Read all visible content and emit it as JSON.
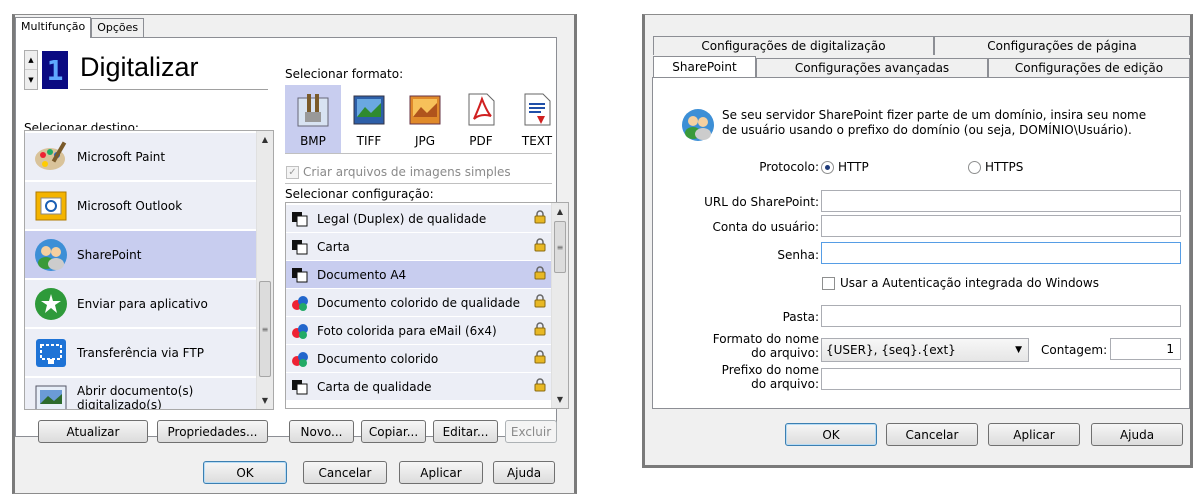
{
  "left_window": {
    "tabs": [
      {
        "label": "Multifunção"
      },
      {
        "label": "Opções"
      }
    ],
    "lcd_digit": "1",
    "title": "Digitalizar",
    "destination_label": "Selecionar destino:",
    "destinations": [
      {
        "label": "Microsoft Paint",
        "icon": "paint-palette-icon"
      },
      {
        "label": "Microsoft Outlook",
        "icon": "outlook-icon"
      },
      {
        "label": "SharePoint",
        "icon": "sharepoint-users-icon"
      },
      {
        "label": "Enviar para aplicativo",
        "icon": "send-app-icon"
      },
      {
        "label": "Transferência via FTP",
        "icon": "ftp-icon"
      },
      {
        "label": "Abrir documento(s) digitalizado(s)",
        "icon": "open-document-icon"
      }
    ],
    "format_label": "Selecionar formato:",
    "formats": [
      {
        "label": "BMP",
        "icon": "bmp-icon"
      },
      {
        "label": "TIFF",
        "icon": "tiff-icon"
      },
      {
        "label": "JPG",
        "icon": "jpg-icon"
      },
      {
        "label": "PDF",
        "icon": "pdf-icon"
      },
      {
        "label": "TEXT",
        "icon": "text-icon"
      }
    ],
    "simple_images_checkbox": "Criar arquivos de imagens simples",
    "config_label": "Selecionar configuração:",
    "configs": [
      {
        "label": "Legal (Duplex) de qualidade",
        "icon": "bw-doc-icon"
      },
      {
        "label": "Carta",
        "icon": "bw-doc-icon"
      },
      {
        "label": "Documento A4",
        "icon": "bw-doc-icon"
      },
      {
        "label": "Documento colorido de qualidade",
        "icon": "color-doc-icon"
      },
      {
        "label": "Foto colorida para eMail (6x4)",
        "icon": "color-doc-icon"
      },
      {
        "label": "Documento colorido",
        "icon": "color-doc-icon"
      },
      {
        "label": "Carta de qualidade",
        "icon": "bw-doc-icon"
      }
    ],
    "buttons": {
      "refresh": "Atualizar",
      "properties": "Propriedades...",
      "new": "Novo...",
      "copy": "Copiar...",
      "edit": "Editar...",
      "delete": "Excluir",
      "ok": "OK",
      "cancel": "Cancelar",
      "apply": "Aplicar",
      "help": "Ajuda"
    }
  },
  "right_window": {
    "tabs_row1": [
      {
        "label": "Configurações de digitalização"
      },
      {
        "label": "Configurações de página"
      }
    ],
    "tabs_row2": [
      {
        "label": "SharePoint"
      },
      {
        "label": "Configurações avançadas"
      },
      {
        "label": "Configurações de edição"
      }
    ],
    "info_line1": "Se seu servidor SharePoint fizer parte de um domínio, insira seu nome",
    "info_line2": "de usuário usando o prefixo do domínio (ou seja, DOMÍNIO\\Usuário).",
    "protocol_label": "Protocolo:",
    "protocol_http": "HTTP",
    "protocol_https": "HTTPS",
    "url_label": "URL do SharePoint:",
    "url_value": "",
    "user_label": "Conta do usuário:",
    "user_value": "",
    "password_label": "Senha:",
    "password_value": "",
    "windows_auth_label": "Usar a Autenticação integrada do Windows",
    "folder_label": "Pasta:",
    "folder_value": "",
    "filename_format_label_1": "Formato do nome",
    "filename_format_label_2": "do arquivo:",
    "filename_format_value": "{USER}, {seq}.{ext}",
    "count_label": "Contagem:",
    "count_value": "1",
    "prefix_label_1": "Prefixo do nome",
    "prefix_label_2": "do arquivo:",
    "prefix_value": "",
    "buttons": {
      "ok": "OK",
      "cancel": "Cancelar",
      "apply": "Aplicar",
      "help": "Ajuda"
    }
  }
}
